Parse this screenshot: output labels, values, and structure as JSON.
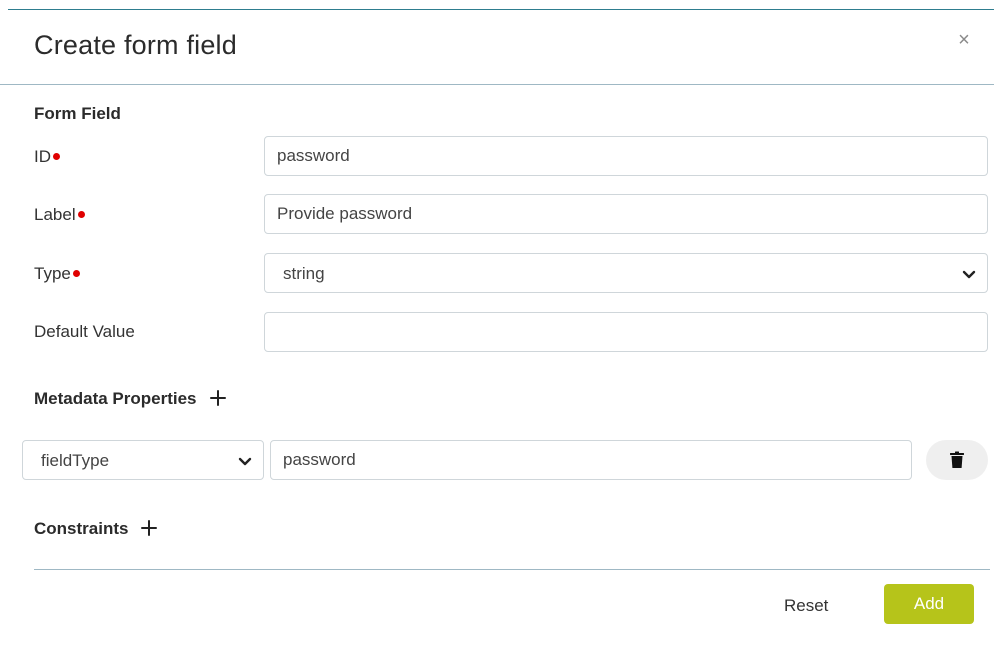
{
  "dialog": {
    "title": "Create form field",
    "close_icon": "close-icon",
    "close_glyph": "×"
  },
  "form_field": {
    "section_title": "Form Field",
    "id": {
      "label": "ID",
      "value": "password",
      "required": true
    },
    "label": {
      "label": "Label",
      "value": "Provide password",
      "required": true
    },
    "type": {
      "label": "Type",
      "value": "string",
      "required": true
    },
    "default_value": {
      "label": "Default Value",
      "value": ""
    }
  },
  "metadata": {
    "section_title": "Metadata Properties",
    "add_icon": "plus-icon",
    "rows": [
      {
        "key": "fieldType",
        "value": "password",
        "delete_icon": "trash-icon"
      }
    ]
  },
  "constraints": {
    "section_title": "Constraints",
    "add_icon": "plus-icon"
  },
  "footer": {
    "reset_label": "Reset",
    "add_label": "Add"
  },
  "colors": {
    "accent": "#b6c41a",
    "required": "#e00000",
    "divider": "#9fb8c4"
  }
}
